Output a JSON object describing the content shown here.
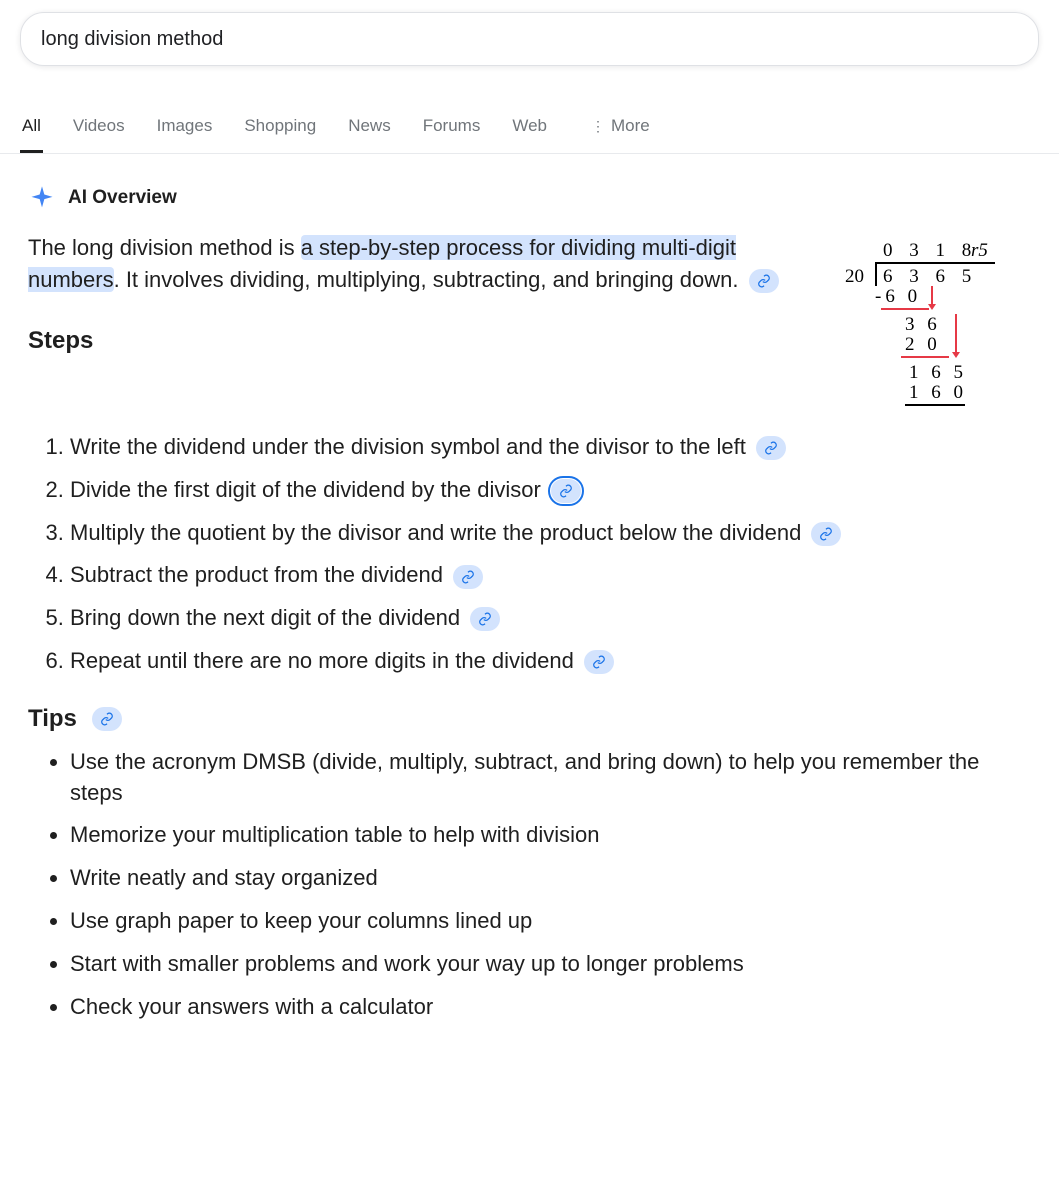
{
  "search": {
    "query": "long division method"
  },
  "tabs": [
    {
      "label": "All",
      "active": true
    },
    {
      "label": "Videos",
      "active": false
    },
    {
      "label": "Images",
      "active": false
    },
    {
      "label": "Shopping",
      "active": false
    },
    {
      "label": "News",
      "active": false
    },
    {
      "label": "Forums",
      "active": false
    },
    {
      "label": "Web",
      "active": false
    }
  ],
  "more_label": "More",
  "overview": {
    "title": "AI Overview",
    "intro_prefix": "The long division method is ",
    "intro_highlight": "a step-by-step process for dividing multi-digit numbers",
    "intro_suffix": ". It involves dividing, multiplying, subtracting, and bringing down.",
    "example": {
      "quotient": "0 3 1 8",
      "remainder_label": "r5",
      "divisor": "20",
      "dividend": "6 3 6 5",
      "step1_sub": "-6 0",
      "step2_val": "3 6",
      "step2_sub": "2 0",
      "step3_val": "1 6 5",
      "step3_sub": "1 6 0"
    },
    "steps_heading": "Steps",
    "steps": [
      "Write the dividend under the division symbol and the divisor to the left",
      "Divide the first digit of the dividend by the divisor",
      "Multiply the quotient by the divisor and write the product below the dividend",
      "Subtract the product from the dividend",
      "Bring down the next digit of the dividend",
      "Repeat until there are no more digits in the dividend"
    ],
    "tips_heading": "Tips",
    "tips": [
      "Use the acronym DMSB (divide, multiply, subtract, and bring down) to help you remember the steps",
      "Memorize your multiplication table to help with division",
      "Write neatly and stay organized",
      "Use graph paper to keep your columns lined up",
      "Start with smaller problems and work your way up to longer problems",
      "Check your answers with a calculator"
    ]
  }
}
